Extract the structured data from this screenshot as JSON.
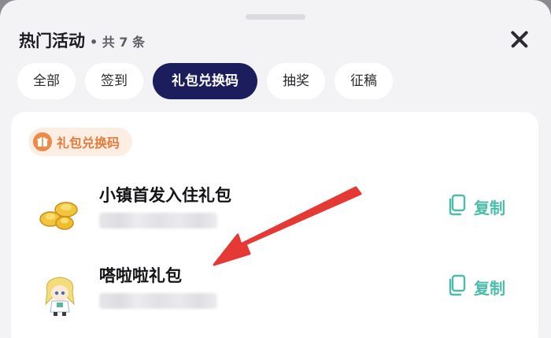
{
  "header": {
    "title": "热门活动",
    "count_text": "• 共 7 条"
  },
  "tabs": [
    {
      "label": "全部",
      "active": false
    },
    {
      "label": "签到",
      "active": false
    },
    {
      "label": "礼包兑换码",
      "active": true
    },
    {
      "label": "抽奖",
      "active": false
    },
    {
      "label": "征稿",
      "active": false
    }
  ],
  "section": {
    "label": "礼包兑换码",
    "icon": "gift-icon"
  },
  "items": [
    {
      "name": "小镇首发入住礼包",
      "code": "",
      "copy_label": "复制",
      "thumb": "gold-ingot-icon"
    },
    {
      "name": "嗒啦啦礼包",
      "code": "",
      "copy_label": "复制",
      "thumb": "character-avatar-icon"
    }
  ],
  "colors": {
    "active_tab": "#1c1d5c",
    "accent_orange": "#ec8a4a",
    "copy_teal": "#4bbcaa",
    "annotation_arrow": "#e53935"
  }
}
